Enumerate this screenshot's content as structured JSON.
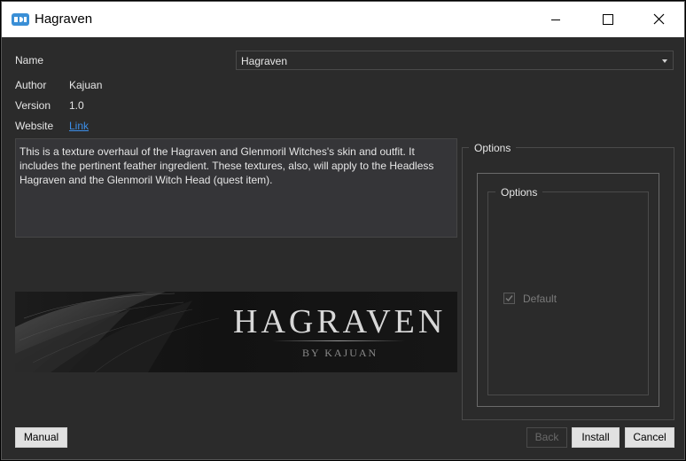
{
  "window": {
    "title": "Hagraven"
  },
  "fields": {
    "name_label": "Name",
    "name_value": "Hagraven",
    "author_label": "Author",
    "author_value": "Kajuan",
    "version_label": "Version",
    "version_value": "1.0",
    "website_label": "Website",
    "website_link": "Link"
  },
  "description": "This is a texture overhaul of the Hagraven and Glenmoril Witches's skin and outfit. It includes the pertinent feather ingredient. These textures, also, will apply to the Headless Hagraven and the Glenmoril Witch Head (quest item).",
  "banner": {
    "title": "HAGRAVEN",
    "subtitle": "BY KAJUAN"
  },
  "options": {
    "outer_label": "Options",
    "inner_label": "Options",
    "items": [
      {
        "label": "Default",
        "checked": true,
        "enabled": false
      }
    ]
  },
  "buttons": {
    "manual": "Manual",
    "back": "Back",
    "install": "Install",
    "cancel": "Cancel"
  },
  "colors": {
    "window_bg": "#2b2b2b",
    "text": "#e6e6e6",
    "link": "#3c8ee8",
    "titlebar": "#ffffff"
  },
  "icons": {
    "app": "app-logo-icon",
    "minimize": "minimize-icon",
    "maximize": "maximize-icon",
    "close": "close-icon",
    "dropdown": "chevron-down-icon",
    "check": "checkmark-icon"
  }
}
